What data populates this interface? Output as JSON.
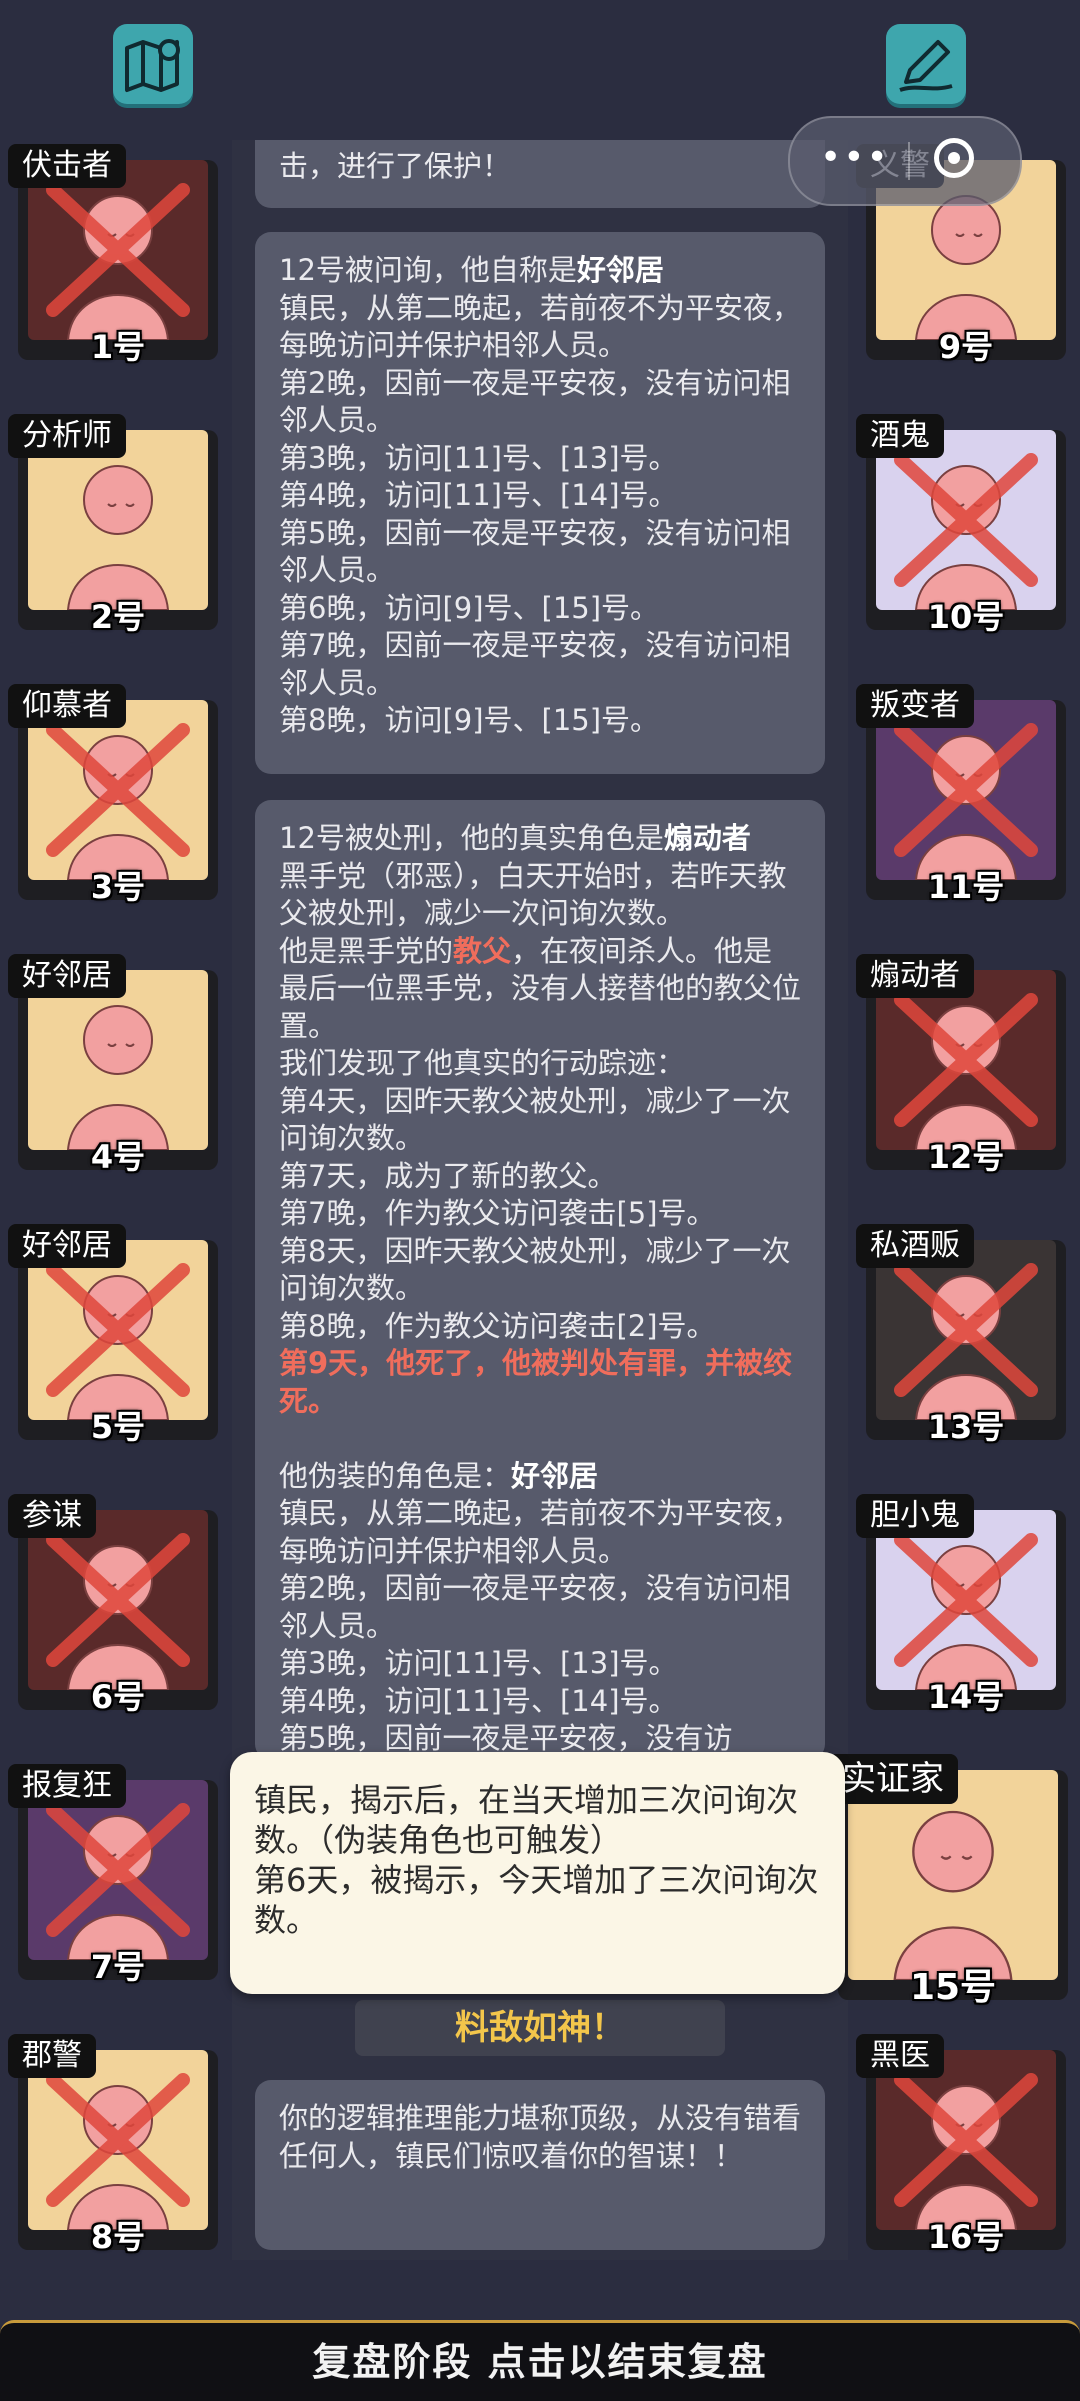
{
  "top": {
    "map_icon": "map-pin-icon",
    "note_icon": "edit-pen-icon"
  },
  "mini_program": {
    "menu_dots": "•••"
  },
  "left_column": [
    {
      "role": "伏击者",
      "number": "1号",
      "eliminated": true
    },
    {
      "role": "分析师",
      "number": "2号",
      "eliminated": false
    },
    {
      "role": "仰慕者",
      "number": "3号",
      "eliminated": true
    },
    {
      "role": "好邻居",
      "number": "4号",
      "eliminated": false
    },
    {
      "role": "好邻居",
      "number": "5号",
      "eliminated": true
    },
    {
      "role": "参谋",
      "number": "6号",
      "eliminated": true
    },
    {
      "role": "报复狂",
      "number": "7号",
      "eliminated": true
    },
    {
      "role": "郡警",
      "number": "8号",
      "eliminated": true
    }
  ],
  "right_column": [
    {
      "role": "义警",
      "number": "9号",
      "eliminated": false
    },
    {
      "role": "酒鬼",
      "number": "10号",
      "eliminated": true
    },
    {
      "role": "叛变者",
      "number": "11号",
      "eliminated": true
    },
    {
      "role": "煽动者",
      "number": "12号",
      "eliminated": true
    },
    {
      "role": "私酒贩",
      "number": "13号",
      "eliminated": true
    },
    {
      "role": "胆小鬼",
      "number": "14号",
      "eliminated": true
    },
    {
      "role": "实证家",
      "number": "15号",
      "eliminated": false
    },
    {
      "role": "黑医",
      "number": "16号",
      "eliminated": true
    }
  ],
  "log": {
    "box0": "击，进行了保护！",
    "box1": {
      "intro_prefix": "12号被问询，他自称是",
      "intro_role": "好邻居",
      "lines": [
        "镇民，从第二晚起，若前夜不为平安夜，每晚访问并保护相邻人员。",
        "第2晚，因前一夜是平安夜，没有访问相邻人员。",
        "第3晚，访问[11]号、[13]号。",
        "第4晚，访问[11]号、[14]号。",
        "第5晚，因前一夜是平安夜，没有访问相邻人员。",
        "第6晚，访问[9]号、[15]号。",
        "第7晚，因前一夜是平安夜，没有访问相邻人员。",
        "第8晚，访问[9]号、[15]号。"
      ]
    },
    "box2": {
      "intro_prefix": "12号被处刑，他的真实角色是",
      "intro_role": "煽动者",
      "desc": "黑手党（邪恶），白天开始时，若昨天教父被处刑，减少一次问询次数。",
      "godfather_prefix": "他是黑手党的",
      "godfather_word": "教父",
      "godfather_suffix": "，在夜间杀人。他是最后一位黑手党，没有人接替他的教父位置。",
      "trace_lines": [
        "我们发现了他真实的行动踪迹：",
        "第4天，因昨天教父被处刑，减少了一次问询次数。",
        "第7天，成为了新的教父。",
        "第7晚，作为教父访问袭击[5]号。",
        "第8天，因昨天教父被处刑，减少了一次问询次数。",
        "第8晚，作为教父访问袭击[2]号。"
      ],
      "death": "第9天，他死了，他被判处有罪，并被绞死。",
      "disguise_prefix": "他伪装的角色是：",
      "disguise_role": "好邻居",
      "disguise_lines": [
        "镇民，从第二晚起，若前夜不为平安夜，每晚访问并保护相邻人员。",
        "第2晚，因前一夜是平安夜，没有访问相邻人员。",
        "第3晚，访问[11]号、[13]号。",
        "第4晚，访问[11]号、[14]号。",
        "第5晚，因前一夜是平安夜，没有访"
      ]
    },
    "tooltip": [
      "镇民，揭示后，在当天增加三次问询次数。（伪装角色也可触发）",
      "第6天，被揭示，今天增加了三次问询次数。"
    ],
    "achievement": "料敌如神！",
    "final_text": "你的逻辑推理能力堪称顶级，从没有错看任何人，镇民们惊叹着你的智谋！！"
  },
  "bottom_bar": "复盘阶段 点击以结束复盘",
  "colors": {
    "background": "#2b2d40",
    "accent_red": "#f06d5c",
    "gold": "#f3c64b",
    "teal": "#3ea6ad",
    "slash_red": "#e0473c"
  }
}
